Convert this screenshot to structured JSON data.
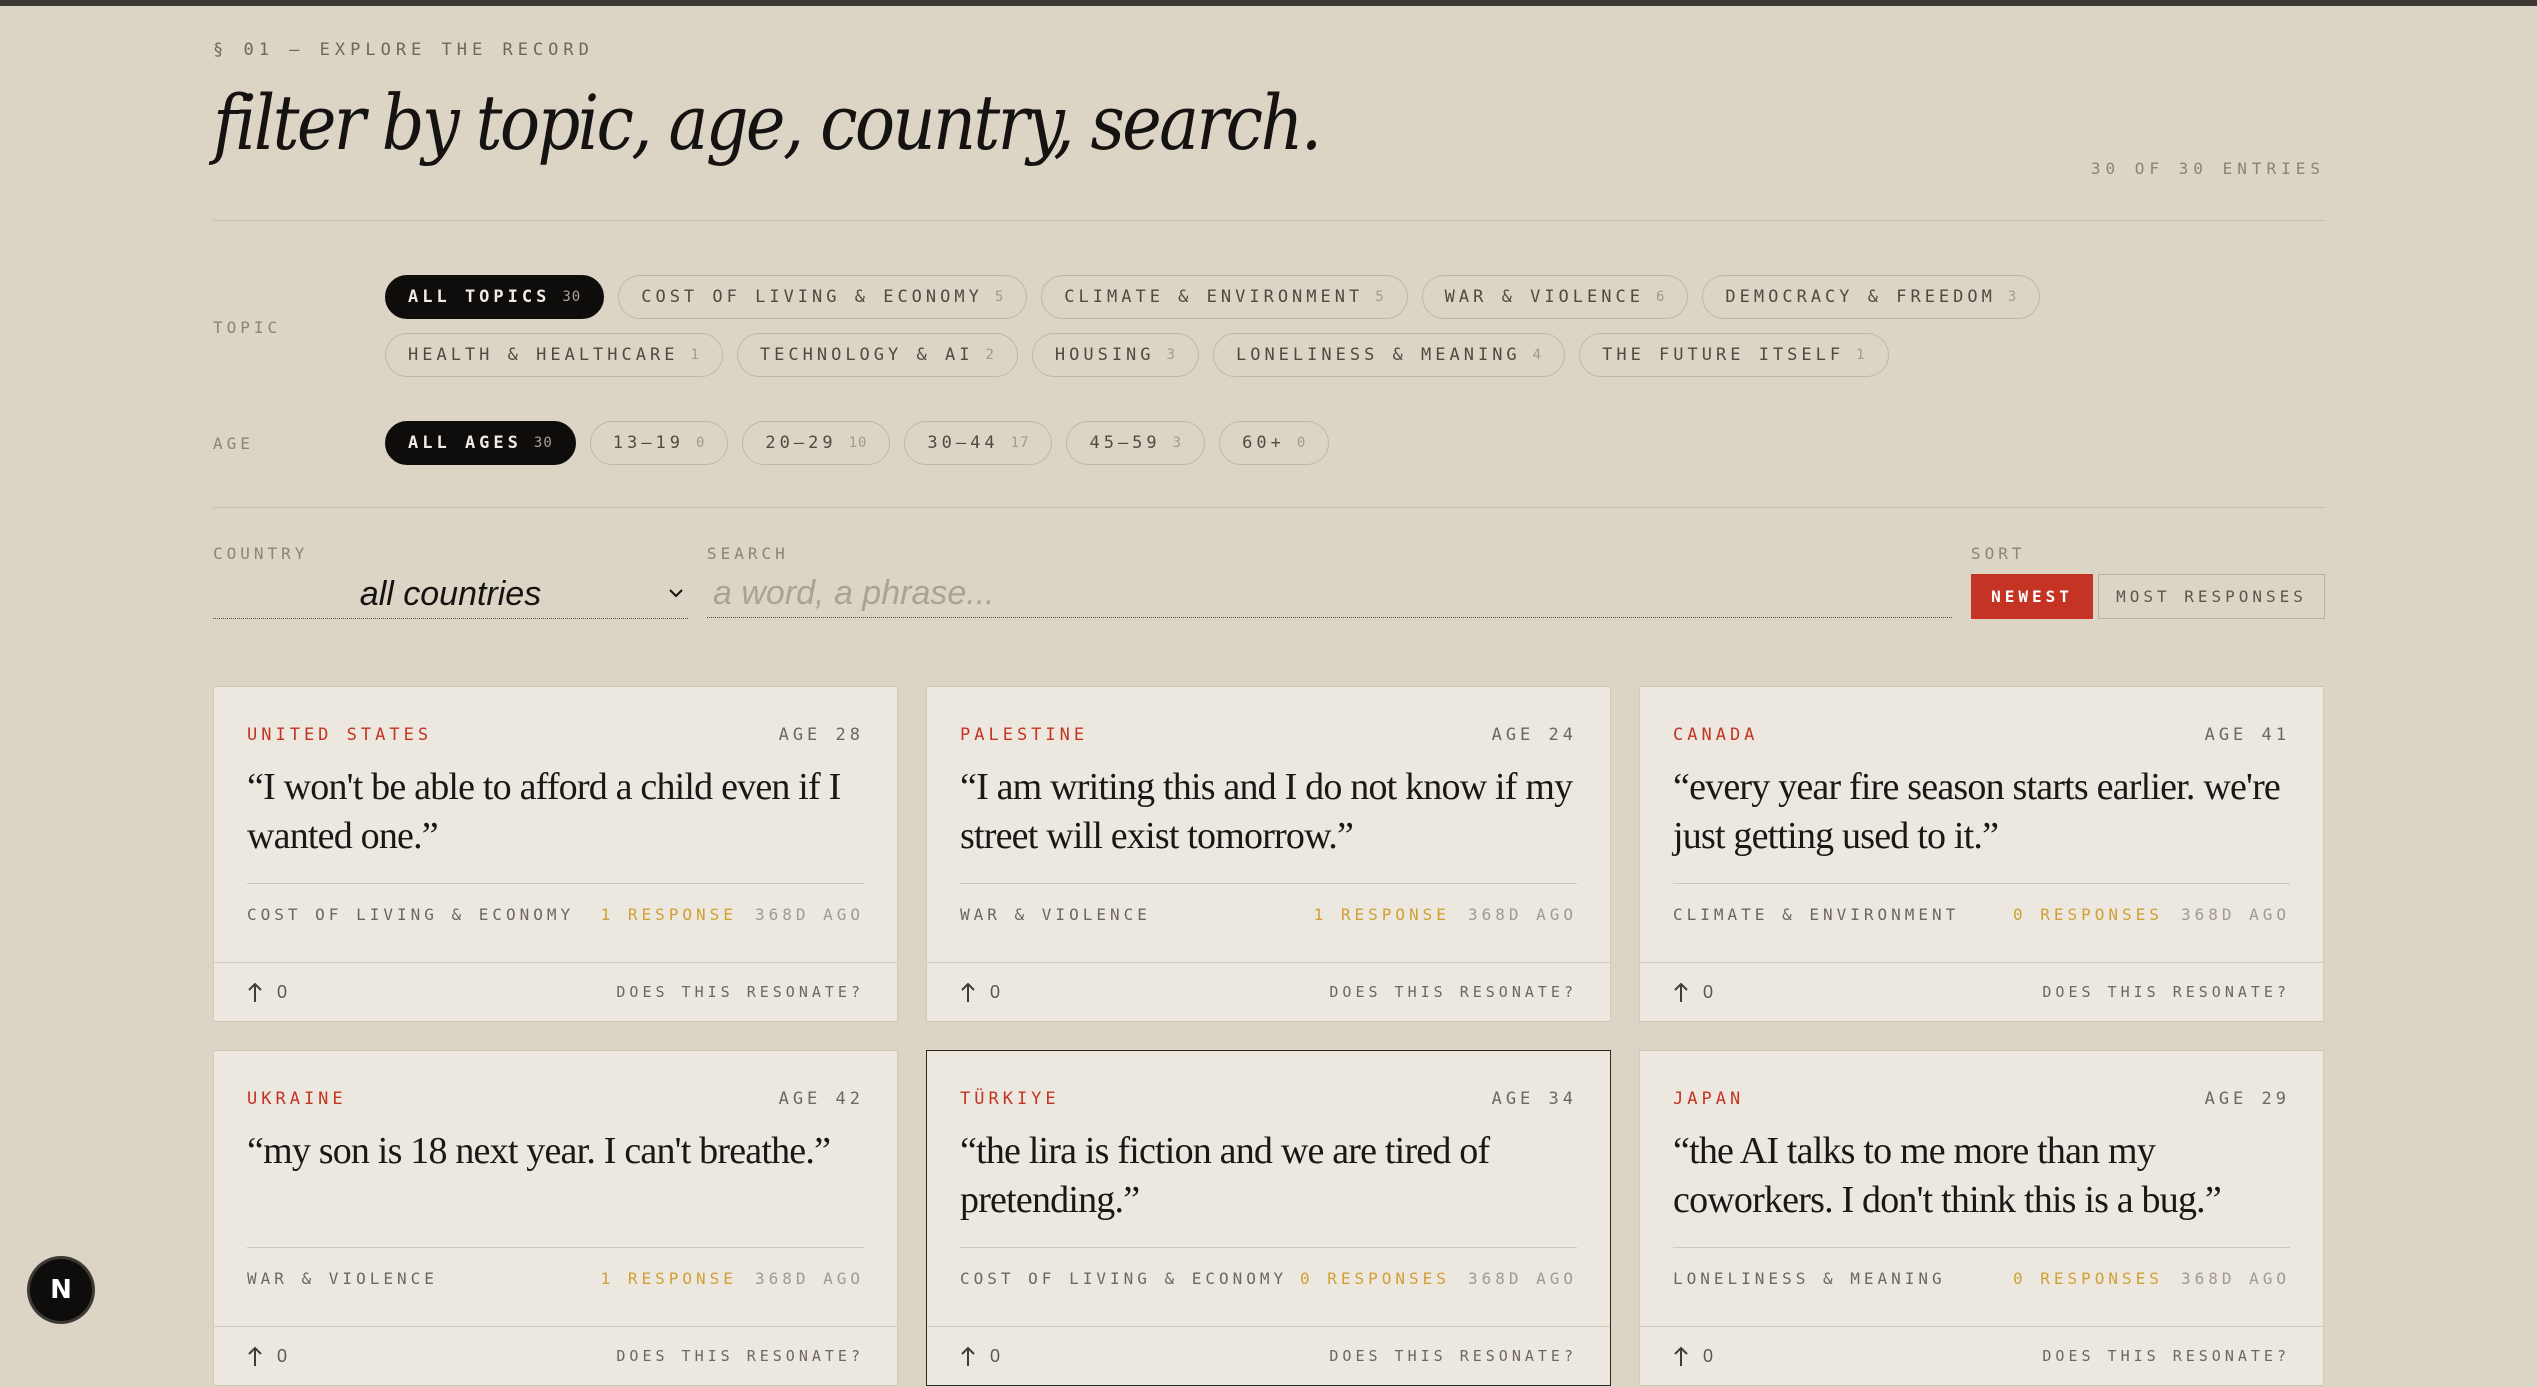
{
  "header": {
    "eyebrow": "§ 01 — EXPLORE THE RECORD",
    "title": "filter by topic, age, country, search.",
    "entries": "30 OF 30 ENTRIES"
  },
  "filters": {
    "topic_label": "TOPIC",
    "topics": [
      {
        "label": "ALL TOPICS",
        "count": "30",
        "active": true
      },
      {
        "label": "COST OF LIVING & ECONOMY",
        "count": "5"
      },
      {
        "label": "CLIMATE & ENVIRONMENT",
        "count": "5"
      },
      {
        "label": "WAR & VIOLENCE",
        "count": "6"
      },
      {
        "label": "DEMOCRACY & FREEDOM",
        "count": "3"
      },
      {
        "label": "HEALTH & HEALTHCARE",
        "count": "1"
      },
      {
        "label": "TECHNOLOGY & AI",
        "count": "2"
      },
      {
        "label": "HOUSING",
        "count": "3"
      },
      {
        "label": "LONELINESS & MEANING",
        "count": "4"
      },
      {
        "label": "THE FUTURE ITSELF",
        "count": "1"
      }
    ],
    "age_label": "AGE",
    "ages": [
      {
        "label": "ALL AGES",
        "count": "30",
        "active": true
      },
      {
        "label": "13–19",
        "count": "0"
      },
      {
        "label": "20–29",
        "count": "10"
      },
      {
        "label": "30–44",
        "count": "17"
      },
      {
        "label": "45–59",
        "count": "3"
      },
      {
        "label": "60+",
        "count": "0"
      }
    ]
  },
  "controls": {
    "country_label": "COUNTRY",
    "country_value": "all countries",
    "search_label": "SEARCH",
    "search_placeholder": "a word, a phrase...",
    "search_value": "",
    "sort_label": "SORT",
    "sort_newest": "NEWEST",
    "sort_most": "MOST RESPONSES"
  },
  "cards": [
    {
      "country": "UNITED STATES",
      "age": "AGE 28",
      "quote": "“I won't be able to afford a child even if I wanted one.”",
      "topic": "COST OF LIVING & ECONOMY",
      "responses": "1 RESPONSE",
      "ago": "368D AGO",
      "votes": "0",
      "resonate": "DOES THIS RESONATE?"
    },
    {
      "country": "PALESTINE",
      "age": "AGE 24",
      "quote": "“I am writing this and I do not know if my street will exist tomorrow.”",
      "topic": "WAR & VIOLENCE",
      "responses": "1 RESPONSE",
      "ago": "368D AGO",
      "votes": "0",
      "resonate": "DOES THIS RESONATE?"
    },
    {
      "country": "CANADA",
      "age": "AGE 41",
      "quote": "“every year fire season starts earlier. we're just getting used to it.”",
      "topic": "CLIMATE & ENVIRONMENT",
      "responses": "0 RESPONSES",
      "ago": "368D AGO",
      "votes": "0",
      "resonate": "DOES THIS RESONATE?"
    },
    {
      "country": "UKRAINE",
      "age": "AGE 42",
      "quote": "“my son is 18 next year. I can't breathe.”",
      "topic": "WAR & VIOLENCE",
      "responses": "1 RESPONSE",
      "ago": "368D AGO",
      "votes": "0",
      "resonate": "DOES THIS RESONATE?"
    },
    {
      "country": "TÜRKIYE",
      "age": "AGE 34",
      "quote": "“the lira is fiction and we are tired of pretending.”",
      "topic": "COST OF LIVING & ECONOMY",
      "responses": "0 RESPONSES",
      "ago": "368D AGO",
      "votes": "0",
      "resonate": "DOES THIS RESONATE?"
    },
    {
      "country": "JAPAN",
      "age": "AGE 29",
      "quote": "“the AI talks to me more than my coworkers. I don't think this is a bug.”",
      "topic": "LONELINESS & MEANING",
      "responses": "0 RESPONSES",
      "ago": "368D AGO",
      "votes": "0",
      "resonate": "DOES THIS RESONATE?"
    }
  ],
  "badge": "N",
  "colors": {
    "accent": "#c43323",
    "responses": "#d0a035",
    "background": "#dcd4c5",
    "card": "#ece7df"
  }
}
